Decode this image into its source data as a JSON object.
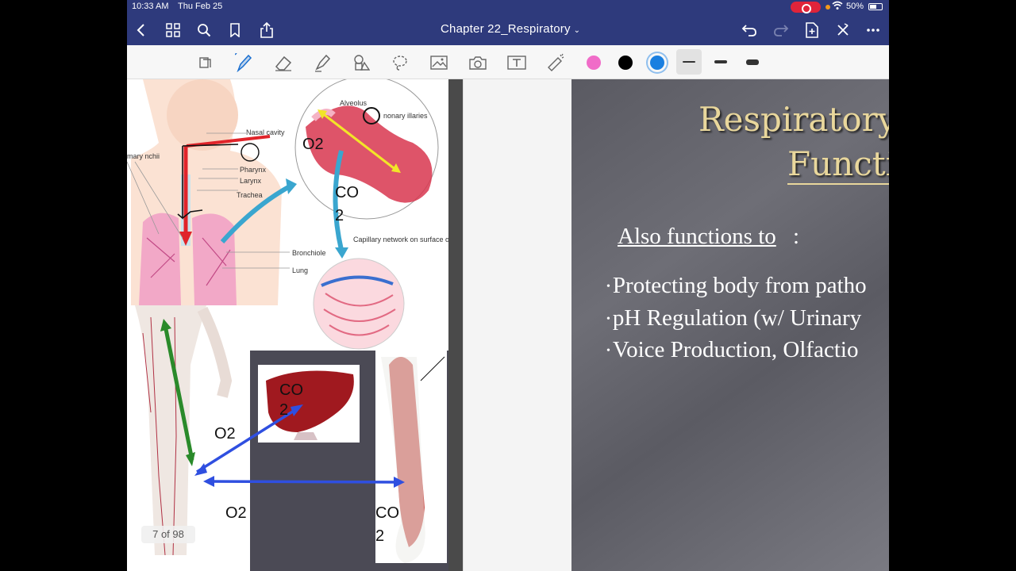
{
  "status": {
    "time": "10:33 AM",
    "date": "Thu Feb 25",
    "battery": "50%"
  },
  "nav": {
    "title": "Chapter 22_Respiratory"
  },
  "colors": {
    "nav_bg": "#2e3a7c",
    "pink": "#f06cc8",
    "black": "#000000",
    "blue": "#1a7fe0"
  },
  "toolbar": {
    "tools": [
      "lasso-shapes-icon",
      "pen-icon",
      "eraser-icon",
      "highlighter-icon",
      "shapes-icon",
      "lasso-icon",
      "image-icon",
      "camera-icon",
      "text-icon",
      "laser-pointer-icon"
    ]
  },
  "left_page": {
    "annotations": {
      "o2_top": "O2",
      "co2_top": "CO\n2",
      "co2_liver": "CO\n2",
      "o2_mid": "O2",
      "o2_bottom": "O2",
      "co2_muscle": "CO\n2"
    },
    "labels": {
      "nasal_cavity": "Nasal cavity",
      "pharynx": "Pharynx",
      "larynx": "Larynx",
      "trachea": "Trachea",
      "bronchiole": "Bronchiole",
      "lung": "Lung",
      "bronchi": "mary\nnchii",
      "alveolus": "Alveolus",
      "capillaries": "nonary\nillaries",
      "capillary_network": "Capillary network on\nsurface of alveolus"
    },
    "page_count": "7 of 98"
  },
  "slide": {
    "title_line1": "Respiratory",
    "title_line2": "Functi",
    "subtitle": "Also functions to",
    "subtitle_colon": ":",
    "bullets": [
      "Protecting body from patho",
      "pH Regulation (w/ Urinary",
      "Voice Production, Olfactio"
    ]
  }
}
